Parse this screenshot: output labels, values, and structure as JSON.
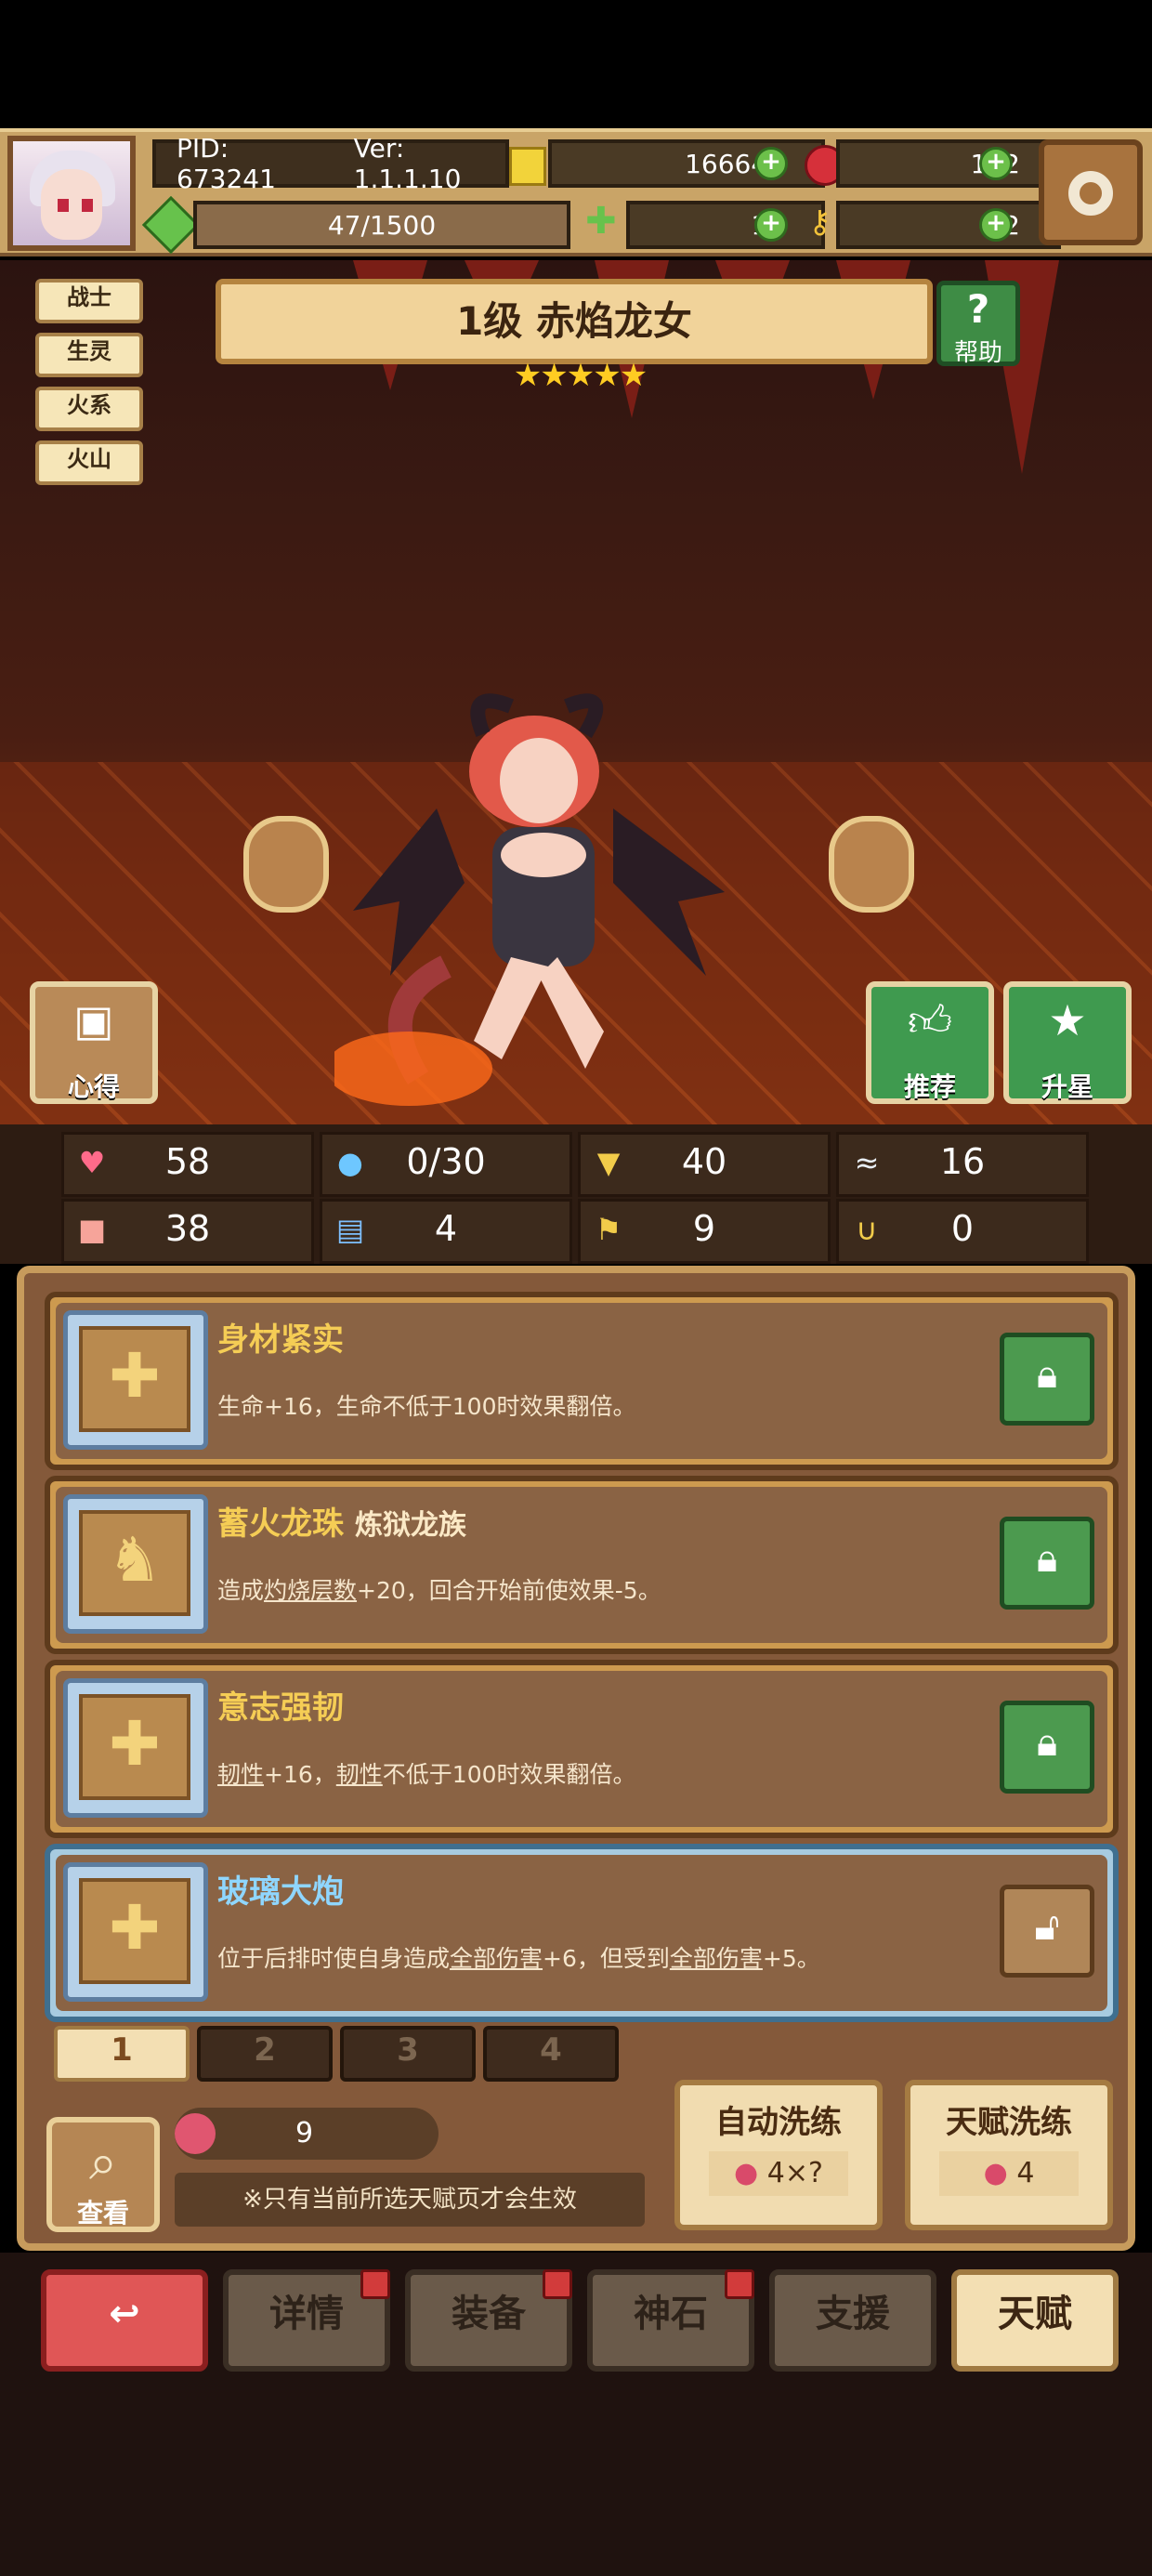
{
  "header": {
    "pid": "PID: 673241",
    "version": "Ver: 1.1.1.10",
    "gold": "166643",
    "gems": "152",
    "stamina": "47/1500",
    "clover": "19",
    "key": "2"
  },
  "tags": [
    "战士",
    "生灵",
    "火系",
    "火山"
  ],
  "hero": {
    "title": "1级 赤焰龙女",
    "stars": "★★★★★",
    "help_icon": "?",
    "help_label": "帮助"
  },
  "actions": {
    "notes_label": "心得",
    "recommend_label": "推荐",
    "star_up_label": "升星"
  },
  "stats": [
    {
      "icon": "heart-icon",
      "glyph": "♥",
      "value": "58"
    },
    {
      "icon": "mana-drop-icon",
      "glyph": "●",
      "value": "0/30"
    },
    {
      "icon": "shield-icon",
      "glyph": "▼",
      "value": "40"
    },
    {
      "icon": "wing-icon",
      "glyph": "≈",
      "value": "16"
    },
    {
      "icon": "fist-icon",
      "glyph": "■",
      "value": "38"
    },
    {
      "icon": "book-icon",
      "glyph": "▤",
      "value": "4"
    },
    {
      "icon": "flag-icon",
      "glyph": "⚑",
      "value": "9"
    },
    {
      "icon": "horseshoe-icon",
      "glyph": "∪",
      "value": "0"
    }
  ],
  "talents": [
    {
      "name": "身材紧实",
      "sub": "",
      "desc": "生命+16，生命不低于100时效果翻倍。",
      "locked": true,
      "selected": false
    },
    {
      "name": "蓄火龙珠",
      "sub": "炼狱龙族",
      "desc_parts": [
        "造成",
        "灼烧层数",
        "+20，回合开始前使效果-5。"
      ],
      "locked": true,
      "selected": false
    },
    {
      "name": "意志强韧",
      "sub": "",
      "desc_parts": [
        "韧性",
        "+16，",
        "韧性",
        "不低于100时效果翻倍。"
      ],
      "locked": true,
      "selected": false
    },
    {
      "name": "玻璃大炮",
      "sub": "",
      "desc_parts": [
        "位于后排时使自身造成",
        "全部伤害",
        "+6，但受到",
        "全部伤害",
        "+5。"
      ],
      "locked": false,
      "selected": true
    }
  ],
  "pages": [
    "1",
    "2",
    "3",
    "4"
  ],
  "footer": {
    "view_label": "查看",
    "fruit_count": "9",
    "note": "※只有当前所选天赋页才会生效",
    "auto_reroll_label": "自动洗练",
    "auto_reroll_cost": "4×?",
    "talent_reroll_label": "天赋洗练",
    "talent_reroll_cost": "4"
  },
  "nav": {
    "details": "详情",
    "equipment": "装备",
    "stone": "神石",
    "support": "支援",
    "talent": "天赋"
  },
  "colors": {
    "accent_gold": "#f5cd55",
    "plus_green": "#6cc04a",
    "selected_blue": "#8fd6ff",
    "back_red": "#e05656"
  }
}
